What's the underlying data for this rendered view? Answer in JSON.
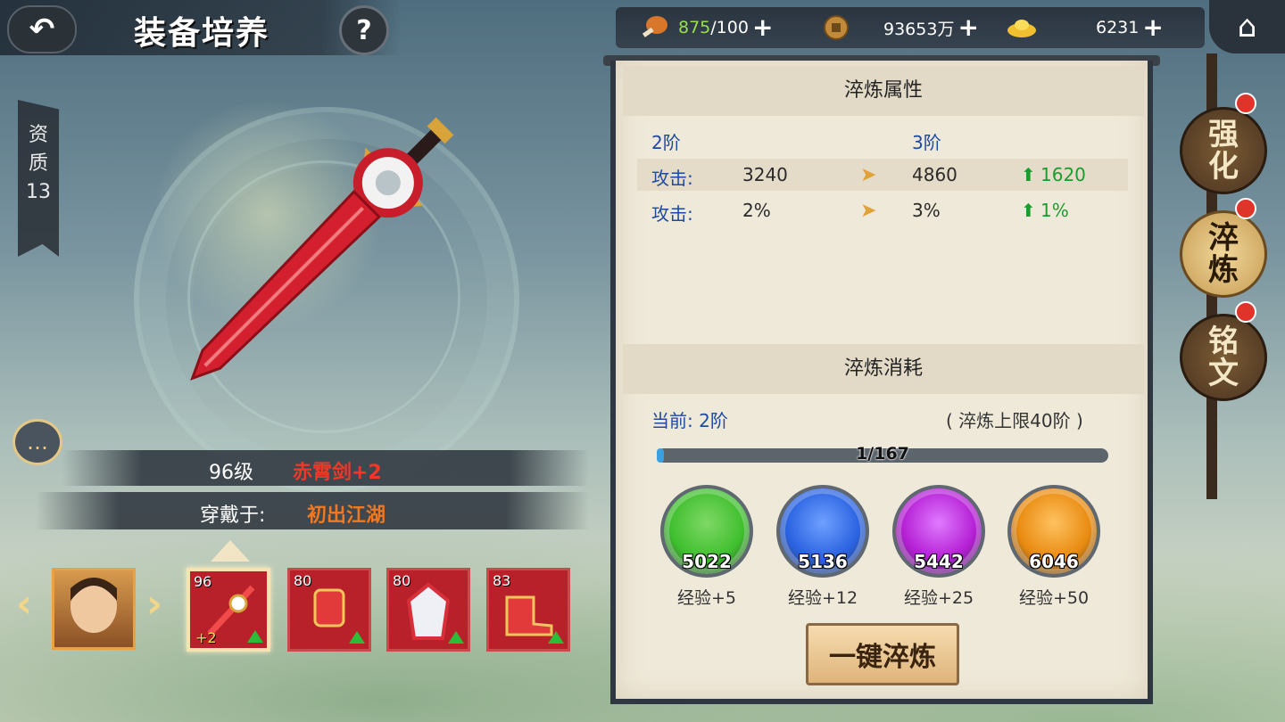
{
  "header": {
    "back_icon": "back-arrow-icon",
    "title": "装备培养",
    "help_label": "?"
  },
  "quality": {
    "label_1": "资",
    "label_2": "质",
    "value": "13"
  },
  "resources": {
    "stamina": {
      "current": "875",
      "max": "/100",
      "icon": "drumstick-icon"
    },
    "coins": {
      "value": "93653万",
      "icon": "copper-coin-icon"
    },
    "gold": {
      "value": "6231",
      "icon": "gold-ingot-icon"
    },
    "plus": "+"
  },
  "refine_attributes": {
    "title": "淬炼属性",
    "current_stage": "2阶",
    "next_stage": "3阶",
    "rows": [
      {
        "label": "攻击:",
        "current": "3240",
        "next": "4860",
        "gain": "1620"
      },
      {
        "label": "攻击:",
        "current": "2%",
        "next": "3%",
        "gain": "1%"
      }
    ],
    "arrow": "➤",
    "up_arrow": "⬆"
  },
  "refine_cost": {
    "title": "淬炼消耗",
    "current_label": "当前: 2阶",
    "limit_label": "( 淬炼上限40阶 )",
    "progress_text": "1/167",
    "progress_fraction": 0.006,
    "gems": [
      {
        "count": "5022",
        "label": "经验+5",
        "color": "#3fbf2e",
        "ring": "#7fd866"
      },
      {
        "count": "5136",
        "label": "经验+12",
        "color": "#2a62e0",
        "ring": "#6fa0ff"
      },
      {
        "count": "5442",
        "label": "经验+25",
        "color": "#b41fd4",
        "ring": "#e07aff"
      },
      {
        "count": "6046",
        "label": "经验+50",
        "color": "#e88a10",
        "ring": "#ffc260"
      }
    ],
    "one_click_label": "一键淬炼"
  },
  "side_tabs": [
    {
      "line1": "强",
      "line2": "化",
      "active": false
    },
    {
      "line1": "淬",
      "line2": "炼",
      "active": true
    },
    {
      "line1": "铭",
      "line2": "文",
      "active": false
    }
  ],
  "item": {
    "level": "96级",
    "name": "赤霄剑+2",
    "worn_label": "穿戴于:",
    "worn_by": "初出江湖"
  },
  "equipment_slots": [
    {
      "level": "96",
      "plus": "+2",
      "selected": true
    },
    {
      "level": "80",
      "plus": "",
      "selected": false
    },
    {
      "level": "80",
      "plus": "",
      "selected": false
    },
    {
      "level": "83",
      "plus": "",
      "selected": false
    }
  ],
  "nav": {
    "prev": "‹",
    "next": "›"
  },
  "colors": {
    "accent_red": "#e03a2a",
    "accent_orange": "#f07820",
    "gain_green": "#1a9c2e",
    "stage_blue": "#1e4aa0"
  }
}
